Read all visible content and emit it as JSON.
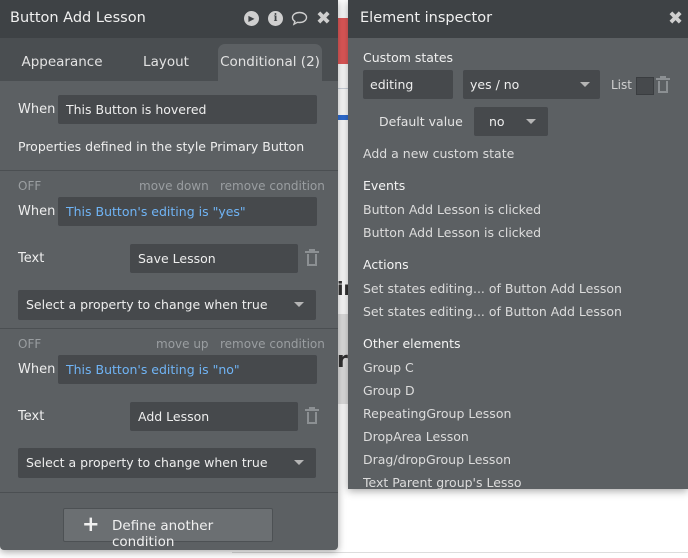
{
  "left_panel": {
    "title": "Button Add Lesson",
    "tabs": [
      "Appearance",
      "Layout",
      "Conditional (2)"
    ],
    "top": {
      "when_label": "When",
      "when_value": "This Button is hovered",
      "note": "Properties defined in the style Primary Button"
    },
    "conditions": [
      {
        "status": "OFF",
        "move": "move down",
        "remove": "remove condition",
        "when_label": "When",
        "when_value": "This Button's editing is \"yes\"",
        "prop_label": "Text",
        "prop_value": "Save Lesson",
        "select_placeholder": "Select a property to change when true"
      },
      {
        "status": "OFF",
        "move": "move up",
        "remove": "remove condition",
        "when_label": "When",
        "when_value": "This Button's editing is \"no\"",
        "prop_label": "Text",
        "prop_value": "Add Lesson",
        "select_placeholder": "Select a property to change when true"
      }
    ],
    "define_button": "Define another condition"
  },
  "right_panel": {
    "title": "Element inspector",
    "custom_states_label": "Custom states",
    "state_name": "editing",
    "state_type": "yes / no",
    "list_label": "List",
    "default_label": "Default value",
    "default_value": "no",
    "add_state": "Add a new custom state",
    "events_label": "Events",
    "events": [
      "Button Add Lesson is clicked",
      "Button Add Lesson is clicked"
    ],
    "actions_label": "Actions",
    "actions": [
      "Set states editing... of Button Add Lesson",
      "Set states editing... of Button Add Lesson"
    ],
    "other_label": "Other elements",
    "other": [
      "Group C",
      "Group D",
      "RepeatingGroup Lesson",
      "DropArea Lesson",
      "Drag/dropGroup Lesson",
      "Text Parent group's Lesso"
    ]
  },
  "background": {
    "fragment_1": "ir",
    "fragment_2": "r"
  },
  "colors": {
    "panel_bg": "#5c6063",
    "titlebar_bg": "#3e4245",
    "field_bg": "#46494c",
    "link_blue": "#70b4f5",
    "accent_red": "#e35a5a"
  }
}
